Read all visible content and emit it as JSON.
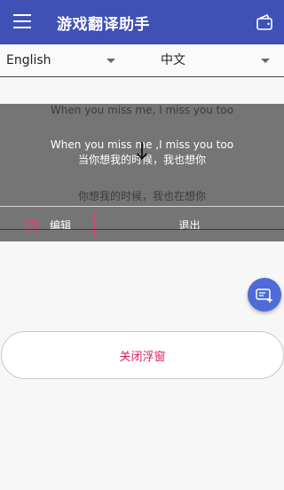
{
  "app": {
    "title": "游戏翻译助手"
  },
  "header": {
    "menu_icon": "menu-icon",
    "wallet_icon": "wallet-icon"
  },
  "language": {
    "source": "English",
    "target": "中文"
  },
  "overlay": {
    "original_line_1": "When you miss me, I miss you too",
    "result_english": "When you miss me ,I miss you too",
    "result_chinese": "当你想我的时候，我也想你",
    "original_line_2": "你想我的时候，我也在想你",
    "edit_label": "编辑",
    "exit_label": "退出"
  },
  "fab": {
    "icon": "add-screenshot-icon"
  },
  "close_overlay_label": "关闭浮窗",
  "colors": {
    "primary": "#3f51b5",
    "accent": "#d81b60",
    "fab": "#4f6bd8",
    "overlay": "#757575"
  }
}
